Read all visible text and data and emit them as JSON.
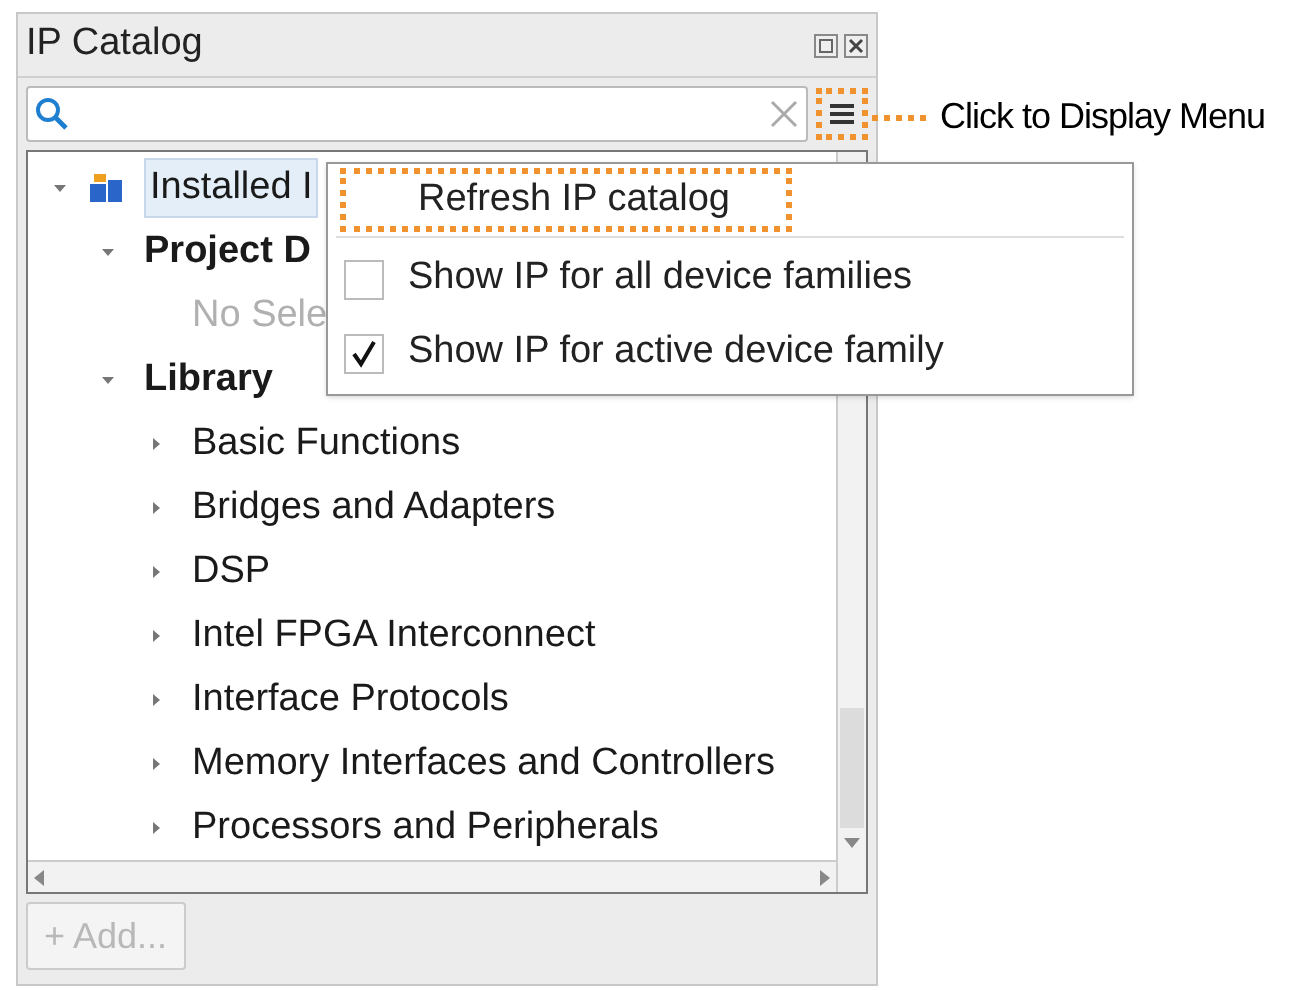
{
  "panel": {
    "title": "IP Catalog"
  },
  "tree": [
    {
      "label": "Installed I",
      "expanded": true,
      "selected": true,
      "bold": false,
      "dim": false,
      "icon": true,
      "children": [
        {
          "label": "Project D",
          "expanded": true,
          "selected": false,
          "bold": true,
          "dim": false,
          "children": [
            {
              "label": "No Sele",
              "selected": false,
              "bold": false,
              "dim": true
            }
          ]
        },
        {
          "label": "Library",
          "expanded": true,
          "selected": false,
          "bold": true,
          "dim": false,
          "children": [
            {
              "label": "Basic Functions",
              "expanded": false,
              "selected": false,
              "bold": false,
              "dim": false
            },
            {
              "label": "Bridges and Adapters",
              "expanded": false,
              "selected": false,
              "bold": false,
              "dim": false
            },
            {
              "label": "DSP",
              "expanded": false,
              "selected": false,
              "bold": false,
              "dim": false
            },
            {
              "label": "Intel FPGA Interconnect",
              "expanded": false,
              "selected": false,
              "bold": false,
              "dim": false
            },
            {
              "label": "Interface Protocols",
              "expanded": false,
              "selected": false,
              "bold": false,
              "dim": false
            },
            {
              "label": "Memory Interfaces and Controllers",
              "expanded": false,
              "selected": false,
              "bold": false,
              "dim": false
            },
            {
              "label": "Processors and Peripherals",
              "expanded": false,
              "selected": false,
              "bold": false,
              "dim": false
            }
          ]
        }
      ]
    }
  ],
  "add_button": {
    "label": "+ Add...",
    "disabled": true
  },
  "menu": [
    {
      "kind": "action",
      "label": "Refresh IP catalog",
      "highlighted": true
    },
    {
      "kind": "checkbox",
      "label": "Show IP for all device families",
      "checked": false
    },
    {
      "kind": "checkbox",
      "label": "Show IP for active device family",
      "checked": true
    }
  ],
  "callout": {
    "text": "Click to Display Menu"
  }
}
